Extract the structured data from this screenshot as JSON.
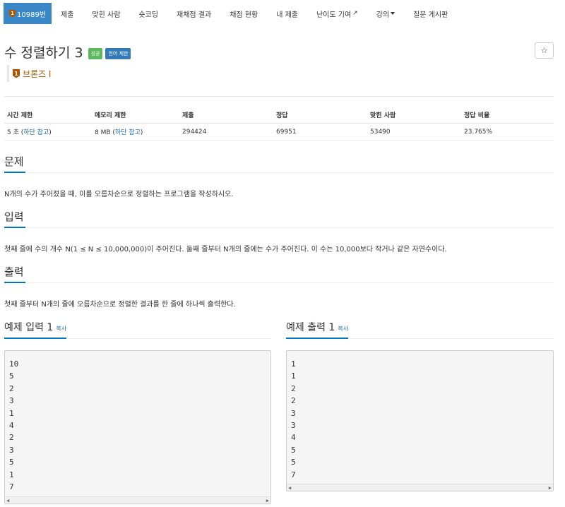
{
  "nav": {
    "problem_number": "10989번",
    "tier_badge": "1",
    "items": [
      "제출",
      "맞힌 사람",
      "숏코딩",
      "재채점 결과",
      "채점 현황",
      "내 제출",
      "난이도 기여",
      "강의",
      "질문 게시판"
    ]
  },
  "problem": {
    "title": "수 정렬하기 3",
    "labels": {
      "success": "성공",
      "language": "언어 제한"
    },
    "star": "☆",
    "tier": "브론즈 I",
    "tier_number": "1"
  },
  "info": {
    "headers": [
      "시간 제한",
      "메모리 제한",
      "제출",
      "정답",
      "맞힌 사람",
      "정답 비율"
    ],
    "time_limit": "5 초",
    "memory_limit": "8 MB",
    "note_link": "하단 참고",
    "submissions": "294424",
    "accepted": "69951",
    "solvers": "53490",
    "ratio": "23.765%"
  },
  "sections": {
    "problem_heading": "문제",
    "problem_text": "N개의 수가 주어졌을 때, 이를 오름차순으로 정렬하는 프로그램을 작성하시오.",
    "input_heading": "입력",
    "input_text": "첫째 줄에 수의 개수 N(1 ≤ N ≤ 10,000,000)이 주어진다. 둘째 줄부터 N개의 줄에는 수가 주어진다. 이 수는 10,000보다 작거나 같은 자연수이다.",
    "output_heading": "출력",
    "output_text": "첫째 줄부터 N개의 줄에 오름차순으로 정렬한 결과를 한 줄에 하나씩 출력한다."
  },
  "samples": {
    "input_heading": "예제 입력 1",
    "output_heading": "예제 출력 1",
    "copy_label": "복사",
    "input_lines": [
      "10",
      "5",
      "2",
      "3",
      "1",
      "4",
      "2",
      "3",
      "5",
      "1",
      "7"
    ],
    "output_lines": [
      "1",
      "1",
      "2",
      "2",
      "3",
      "3",
      "4",
      "5",
      "5",
      "7"
    ]
  },
  "colors": {
    "nav_active": "#3a87c8",
    "bronze": "#ad5600",
    "success": "#5cb85c",
    "primary": "#337ab7",
    "link": "#1a6fad",
    "accent_underline": "#0076c0"
  }
}
